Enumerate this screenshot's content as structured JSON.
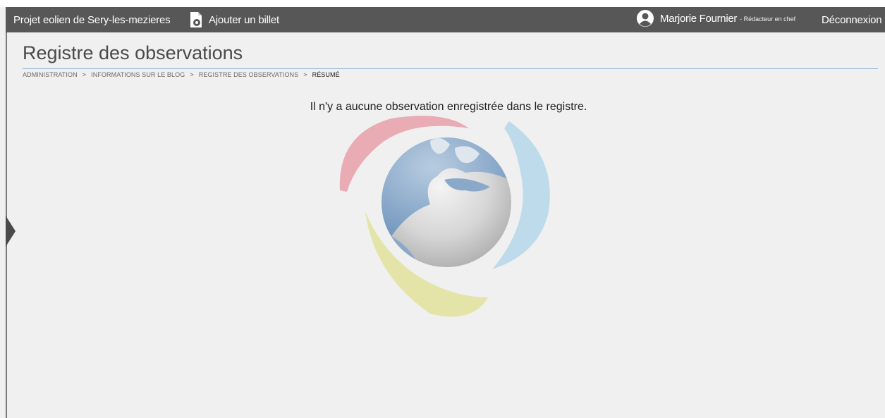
{
  "header": {
    "site_title": "Projet eolien de Sery-les-mezieres",
    "add_post_label": "Ajouter un billet",
    "user_name": "Marjorie Fournier",
    "user_role": "- Rédacteur en chef",
    "logout_label": "Déconnexion"
  },
  "page": {
    "title": "Registre des observations",
    "empty_message": "Il n'y a aucune observation enregistrée dans le registre."
  },
  "breadcrumb": {
    "items": [
      "ADMINISTRATION",
      "INFORMATIONS SUR LE BLOG",
      "REGISTRE DES OBSERVATIONS"
    ],
    "separator": ">",
    "current": "RÉSUMÉ"
  },
  "icons": {
    "add_post": "document-plus-icon",
    "user": "user-avatar-icon",
    "sidebar_toggle": "chevron-right-icon",
    "watermark": "globe-logo"
  },
  "colors": {
    "topbar": "#575757",
    "background": "#f0f0f0",
    "title_rule": "#8fb3d6",
    "logo_red": "#e8a3ad",
    "logo_blue": "#b8d8ea",
    "logo_yellow": "#e2e2a0"
  }
}
